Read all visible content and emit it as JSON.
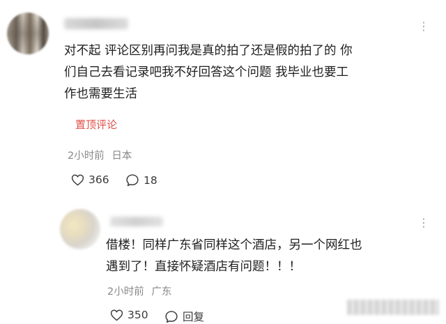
{
  "comment": {
    "text_line1": "对不起 评论区别再问我是真的拍了还是假的拍了的 你",
    "text_line2": "们自己去看记录吧我不好回答这个问题 我毕业也要工",
    "text_line3": "作也需要生活",
    "pin_label": "置顶评论",
    "time": "2小时前",
    "location": "日本",
    "likes": "366",
    "replies": "18"
  },
  "reply": {
    "text_line1": "借楼！同样广东省同样这个酒店，另一个网红也",
    "text_line2": "遇到了！直接怀疑酒店有问题！！！",
    "time": "2小时前",
    "location": "广东",
    "likes": "350",
    "reply_label": "回复"
  },
  "icons": [
    "more-icon",
    "heart-icon",
    "comment-icon"
  ],
  "colors": {
    "pin": "#e0514a",
    "meta": "#888888",
    "text": "#202020"
  }
}
